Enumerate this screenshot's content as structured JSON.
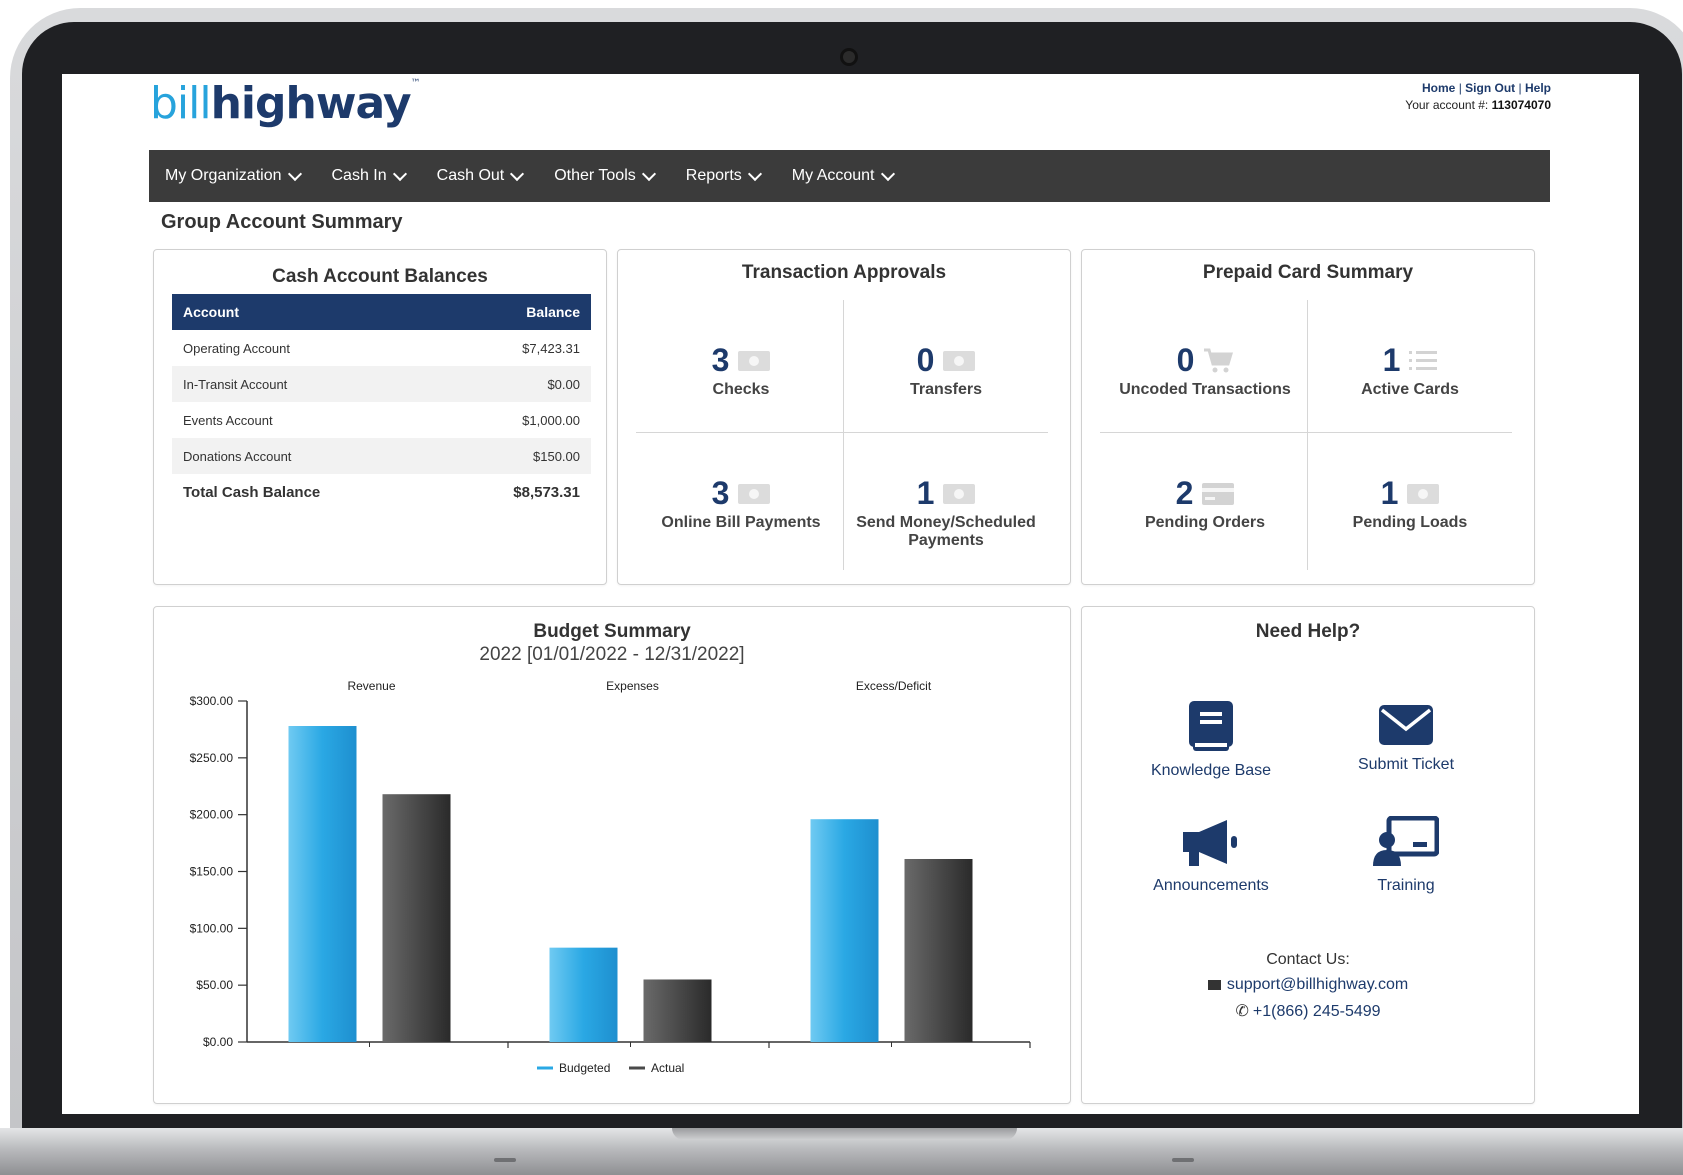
{
  "brand": {
    "bill": "bill",
    "highway": "highway",
    "tm": "™"
  },
  "toplinks": {
    "home": "Home",
    "sign_out": "Sign Out",
    "help": "Help",
    "sep": "|",
    "account_label": "Your account #:",
    "account_number": "113074070"
  },
  "nav": [
    {
      "label": "My Organization"
    },
    {
      "label": "Cash In"
    },
    {
      "label": "Cash Out"
    },
    {
      "label": "Other Tools"
    },
    {
      "label": "Reports"
    },
    {
      "label": "My Account"
    }
  ],
  "page_title": "Group Account Summary",
  "cash": {
    "title": "Cash Account Balances",
    "col_account": "Account",
    "col_balance": "Balance",
    "rows": [
      {
        "account": "Operating Account",
        "balance": "$7,423.31"
      },
      {
        "account": "In-Transit Account",
        "balance": "$0.00"
      },
      {
        "account": "Events Account",
        "balance": "$1,000.00"
      },
      {
        "account": "Donations Account",
        "balance": "$150.00"
      }
    ],
    "total_label": "Total Cash Balance",
    "total_value": "$8,573.31"
  },
  "approvals": {
    "title": "Transaction Approvals",
    "items": [
      {
        "count": "3",
        "label": "Checks",
        "icon": "money-icon"
      },
      {
        "count": "0",
        "label": "Transfers",
        "icon": "money-icon"
      },
      {
        "count": "3",
        "label": "Online Bill Payments",
        "icon": "money-icon"
      },
      {
        "count": "1",
        "label": "Send Money/Scheduled Payments",
        "icon": "money-icon"
      }
    ]
  },
  "prepaid": {
    "title": "Prepaid Card Summary",
    "items": [
      {
        "count": "0",
        "label": "Uncoded Transactions",
        "icon": "cart-icon"
      },
      {
        "count": "1",
        "label": "Active Cards",
        "icon": "list-icon"
      },
      {
        "count": "2",
        "label": "Pending Orders",
        "icon": "credit-card-icon"
      },
      {
        "count": "1",
        "label": "Pending Loads",
        "icon": "money-icon"
      }
    ]
  },
  "budget": {
    "title": "Budget Summary",
    "subtitle": "2022 [01/01/2022 - 12/31/2022]"
  },
  "chart_data": {
    "type": "bar",
    "categories": [
      "Revenue",
      "Expenses",
      "Excess/Deficit"
    ],
    "series": [
      {
        "name": "Budgeted",
        "values": [
          278,
          83,
          196
        ],
        "color": "#2aa8e4"
      },
      {
        "name": "Actual",
        "values": [
          218,
          55,
          161
        ],
        "color": "#4a4a4a"
      }
    ],
    "y_ticks": [
      "$0.00",
      "$50.00",
      "$100.00",
      "$150.00",
      "$200.00",
      "$250.00",
      "$300.00"
    ],
    "ylim": [
      0,
      300
    ],
    "legend": "bottom-center",
    "grid": false
  },
  "help": {
    "title": "Need Help?",
    "items": [
      {
        "label": "Knowledge Base",
        "icon": "book-icon"
      },
      {
        "label": "Submit Ticket",
        "icon": "envelope-icon"
      },
      {
        "label": "Announcements",
        "icon": "megaphone-icon"
      },
      {
        "label": "Training",
        "icon": "training-icon"
      }
    ],
    "contact_label": "Contact Us:",
    "email": "support@billhighway.com",
    "phone": "+1(866) 245-5499"
  },
  "colors": {
    "navy": "#1d3a6b",
    "blue": "#2aa8e4",
    "nav_bg": "#3b3b3b"
  }
}
